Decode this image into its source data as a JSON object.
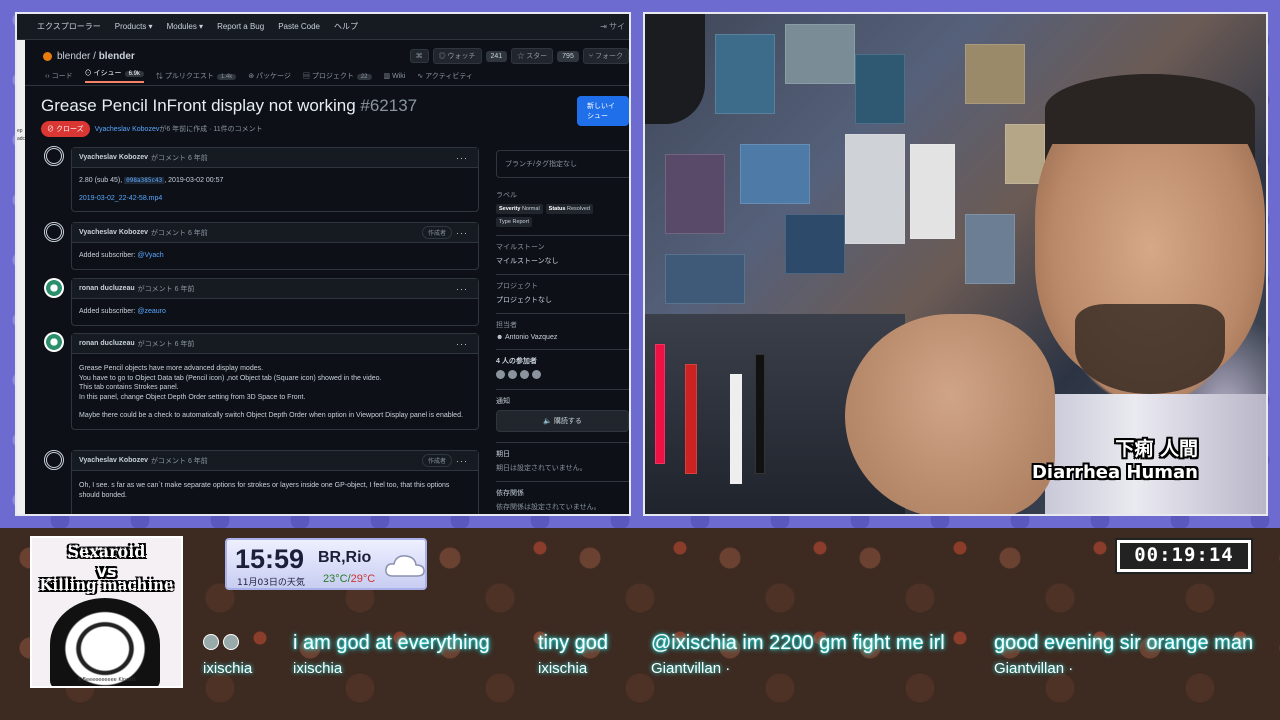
{
  "browser": {
    "nav": [
      "エクスプローラー",
      "Products ▾",
      "Modules ▾",
      "Report a Bug",
      "Paste Code",
      "ヘルプ"
    ],
    "sign_in": "⇥ サイ",
    "repo": {
      "owner": "blender",
      "name": "blender",
      "rss": "⌘",
      "watch_label": "ウォッチ",
      "watch_count": "241",
      "star_label": "スター",
      "star_count": "795",
      "fork_label": "フォーク"
    },
    "tabs": [
      {
        "label": "‹› コード",
        "count": ""
      },
      {
        "label": "⊙ イシュー",
        "count": "6.9k"
      },
      {
        "label": "⇅ プルリクエスト",
        "count": "1.4k"
      },
      {
        "label": "⊛ パッケージ",
        "count": ""
      },
      {
        "label": "▤ プロジェクト",
        "count": "22"
      },
      {
        "label": "▥ Wiki",
        "count": ""
      },
      {
        "label": "∿ アクティビティ",
        "count": ""
      }
    ],
    "gutter": [
      "ep",
      "adc"
    ],
    "issue": {
      "title": "Grease Pencil InFront display not working",
      "number": "#62137",
      "new_button": "新しいイシュー",
      "state": "⊘ クローズ",
      "opened_by": "Vyacheslav Kobozev",
      "meta": "が6 年前に作成 · 11件のコメント"
    },
    "comments": [
      {
        "author": "Vyacheslav Kobozev",
        "when": "がコメント 6 年前",
        "badge": "",
        "lines": [
          "2.80 (sub 45), ",
          "2019-03-02_22-42-58.mp4"
        ],
        "sha": "098a385c43",
        "date": ", 2019-03-02 00:57"
      },
      {
        "author": "Vyacheslav Kobozev",
        "when": "がコメント 6 年前",
        "badge": "作成者",
        "text": "Added subscriber: ",
        "mention": "@Vyach"
      },
      {
        "author": "ronan ducluzeau",
        "when": "がコメント 6 年前",
        "badge": "",
        "text": "Added subscriber: ",
        "mention": "@zeauro"
      },
      {
        "author": "ronan ducluzeau",
        "when": "がコメント 6 年前",
        "badge": "",
        "body": [
          "Grease Pencil objects have more advanced display modes.",
          "You have to go to Object Data tab (Pencil icon) ,not Object tab (Square icon) showed in the video.",
          "This tab contains Strokes panel.",
          "In this panel, change Object Depth Order setting from 3D Space to Front.",
          "",
          "Maybe there could be a check to automatically switch Object Depth Order when option in Viewport Display panel is enabled."
        ]
      },
      {
        "author": "Vyacheslav Kobozev",
        "when": "がコメント 6 年前",
        "badge": "作成者",
        "body": [
          "Oh, I see. s far as we can`t make separate options for strokes or layers inside one GP-object, I feel too, that this options should bonded."
        ]
      }
    ],
    "sidebar": {
      "branch": "ブランチ/タグ指定なし",
      "labels_title": "ラベル",
      "labels": [
        {
          "k": "Severity",
          "v": "Normal"
        },
        {
          "k": "Status",
          "v": "Resolved"
        },
        {
          "k": "Type",
          "v": "Report"
        }
      ],
      "milestone_title": "マイルストーン",
      "milestone": "マイルストーンなし",
      "project_title": "プロジェクト",
      "project": "プロジェクトなし",
      "assignee_title": "担当者",
      "assignee": "Antonio Vazquez",
      "participants_title": "4 人の参加者",
      "notify_title": "通知",
      "subscribe": "🔈 購読する",
      "due_title": "期日",
      "due": "期日は設定されていません。",
      "deps_title": "依存関係",
      "deps": "依存関係は設定されていません。"
    }
  },
  "webcam": {
    "caption_jp": "下痢 人間",
    "caption_en": "Diarrhea Human"
  },
  "overlay": {
    "art": {
      "line1": "Sexaroid",
      "line2": "vs",
      "line3": "Killing machine",
      "credit": "©Beeeeeeeeee Kinokit"
    },
    "clock": {
      "time": "15:59",
      "location": "BR,Rio",
      "date": "11月03日の天気",
      "temp_low": "23°C",
      "sep": "/",
      "temp_high": "29°C"
    },
    "timer": "00:19:14",
    "chat": [
      {
        "msg": "",
        "user": "ixischia"
      },
      {
        "msg": "i am god at everything",
        "user": "ixischia"
      },
      {
        "msg": "tiny god",
        "user": "ixischia"
      },
      {
        "msg": "@ixischia im 2200 gm fight me irl",
        "user": "Giantvillan ·"
      },
      {
        "msg": "good evening sir orange man",
        "user": "Giantvillan ·"
      }
    ]
  }
}
